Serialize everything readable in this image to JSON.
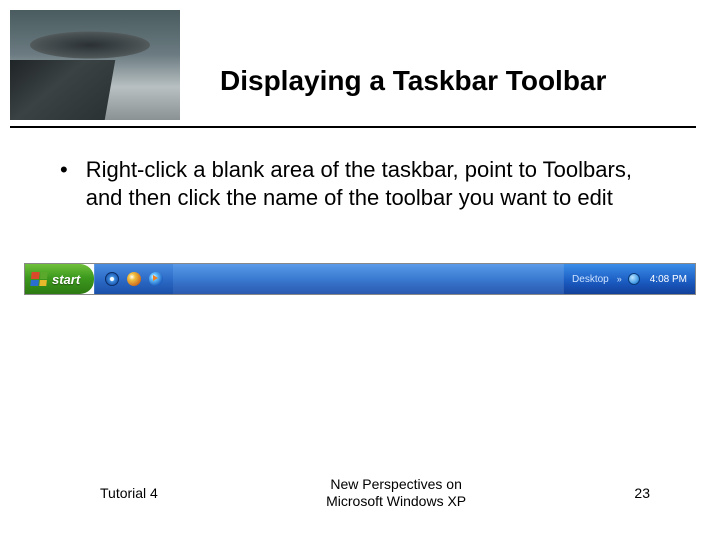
{
  "header": {
    "title": "Displaying a Taskbar Toolbar"
  },
  "content": {
    "bullets": [
      "Right-click a blank area of the taskbar, point to Toolbars, and then click the name of the toolbar you want to edit"
    ]
  },
  "taskbar": {
    "start_label": "start",
    "tray": {
      "desktop_label": "Desktop",
      "chevron": "»",
      "time": "4:08 PM"
    }
  },
  "footer": {
    "left": "Tutorial 4",
    "center_line1": "New Perspectives on",
    "center_line2": "Microsoft Windows XP",
    "page": "23"
  }
}
